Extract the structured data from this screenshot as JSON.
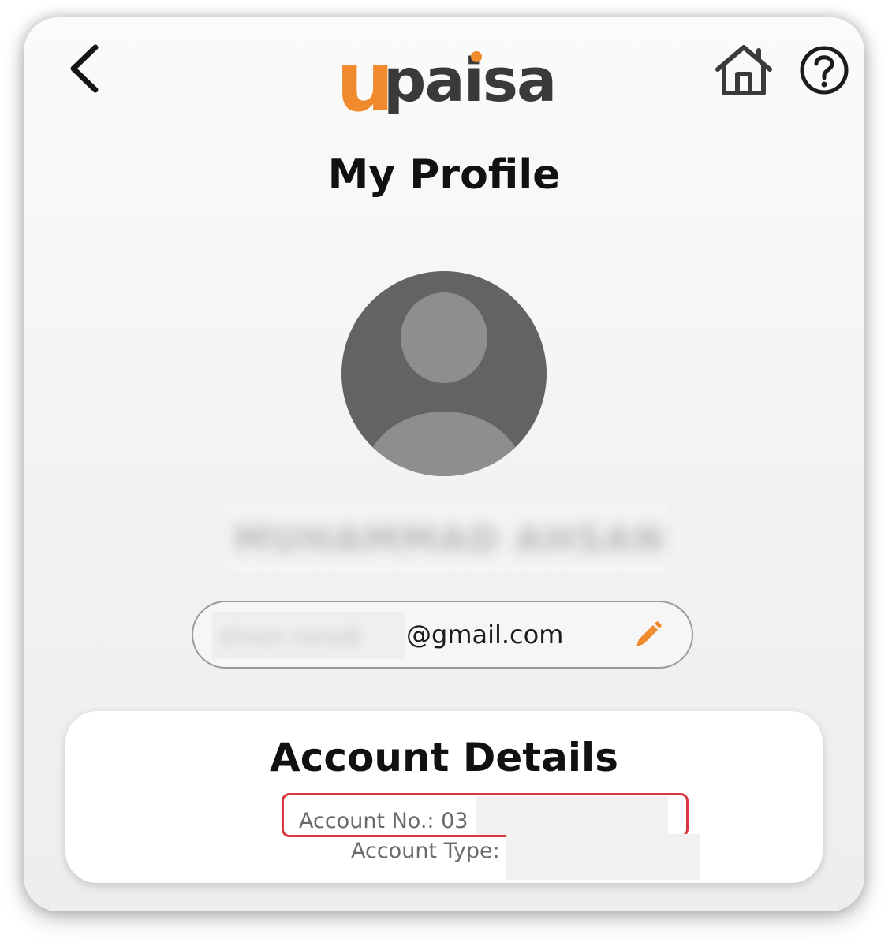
{
  "header": {
    "back_icon": "chevron-left-icon",
    "logo": {
      "u": "u",
      "paisa": "paisa",
      "brand_orange": "#f08a2c",
      "brand_dark": "#3a3a3a"
    },
    "home_icon": "home-icon",
    "help_icon": "question-circle-icon"
  },
  "page": {
    "title": "My Profile"
  },
  "profile": {
    "avatar_icon": "default-avatar-icon",
    "name_redacted": "MUHAMMAD AHSAN",
    "email": {
      "redacted_part": "ahsan.raza@",
      "domain": "@gmail.com",
      "edit_icon": "pencil-icon"
    }
  },
  "account_details": {
    "title": "Account Details",
    "account_no_label": "Account No.: 03",
    "account_type_label": "Account Type:",
    "highlight_color": "#d9373f"
  }
}
